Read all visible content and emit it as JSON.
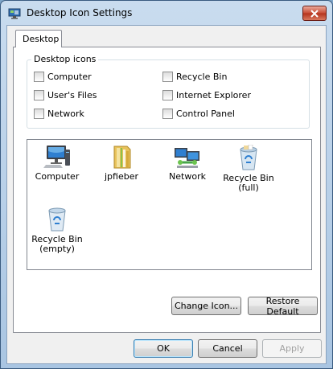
{
  "window": {
    "title": "Desktop Icon Settings"
  },
  "tab": {
    "label": "Desktop"
  },
  "group": {
    "legend": "Desktop icons",
    "checkboxes": [
      {
        "label": "Computer",
        "checked": false
      },
      {
        "label": "User's Files",
        "checked": false
      },
      {
        "label": "Network",
        "checked": false
      },
      {
        "label": "Recycle Bin",
        "checked": false
      },
      {
        "label": "Internet Explorer",
        "checked": false
      },
      {
        "label": "Control Panel",
        "checked": false
      }
    ]
  },
  "icons": [
    {
      "label": "Computer",
      "icon": "computer-icon"
    },
    {
      "label": "jpfieber",
      "icon": "user-folder-icon"
    },
    {
      "label": "Network",
      "icon": "network-icon"
    },
    {
      "label": "Recycle Bin (full)",
      "line1": "Recycle Bin",
      "line2": "(full)",
      "icon": "recycle-bin-full-icon"
    },
    {
      "label": "Recycle Bin (empty)",
      "line1": "Recycle Bin",
      "line2": "(empty)",
      "icon": "recycle-bin-empty-icon"
    }
  ],
  "buttons": {
    "change_icon": "Change Icon...",
    "restore_default": "Restore Default",
    "ok": "OK",
    "cancel": "Cancel",
    "apply": "Apply"
  },
  "colors": {
    "accent": "#3c7fb1",
    "close": "#c74a33"
  }
}
